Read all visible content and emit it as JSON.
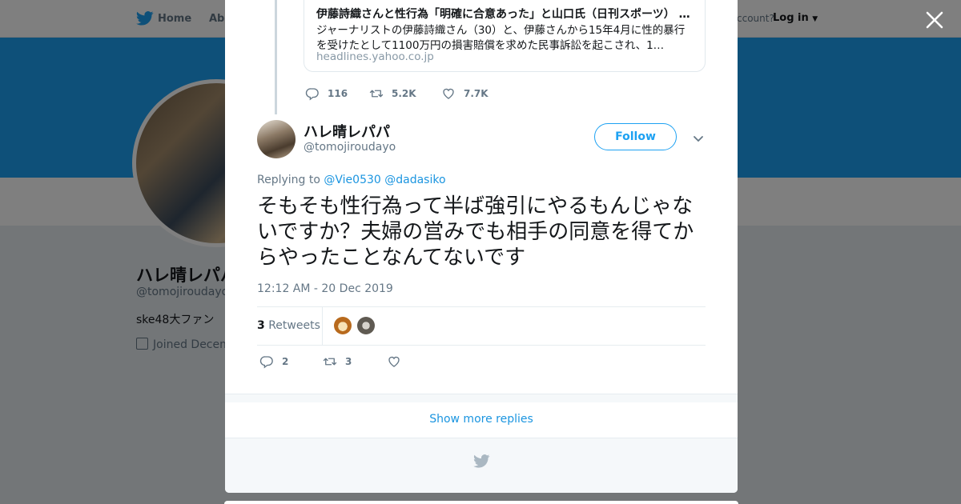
{
  "background_page": {
    "nav": {
      "home": "Home",
      "about": "Abo",
      "account_prompt": "ccount?",
      "login": "Log in"
    },
    "profile": {
      "name": "ハレ晴レパパ",
      "handle": "@tomojiroudayo",
      "bio": "ske48大ファン",
      "joined": "Joined Decem"
    }
  },
  "quoted_tweet": {
    "card": {
      "title": "伊藤詩織さんと性行為「明確に合意あった」と山口氏（日刊スポーツ） - Yahoo!ニュース",
      "description": "ジャーナリストの伊藤詩織さん（30）と、伊藤さんから15年4月に性的暴行を受けたとして1100万円の損害賠償を求めた民事訴訟を起こされ、1…",
      "domain": "headlines.yahoo.co.jp"
    },
    "actions": {
      "replies": "116",
      "retweets": "5.2K",
      "likes": "7.7K"
    }
  },
  "tweet": {
    "author_name": "ハレ晴レパパ",
    "author_handle": "@tomojiroudayo",
    "follow_label": "Follow",
    "replying_prefix": "Replying to",
    "replying_to": [
      "@Vie0530",
      "@dadasiko"
    ],
    "text": "そもそも性行為って半ば強引にやるもんじゃないですか？夫婦の営みでも相手の同意を得てからやったことなんてないです",
    "timestamp": "12:12 AM - 20 Dec 2019",
    "retweet_count": "3",
    "retweets_label": "Retweets",
    "actions": {
      "replies": "2",
      "retweets": "3",
      "likes": ""
    }
  },
  "show_more_label": "Show more replies",
  "colors": {
    "brand": "#1da1f2",
    "link": "#1b95e0",
    "text": "#14171a",
    "muted": "#657786"
  }
}
